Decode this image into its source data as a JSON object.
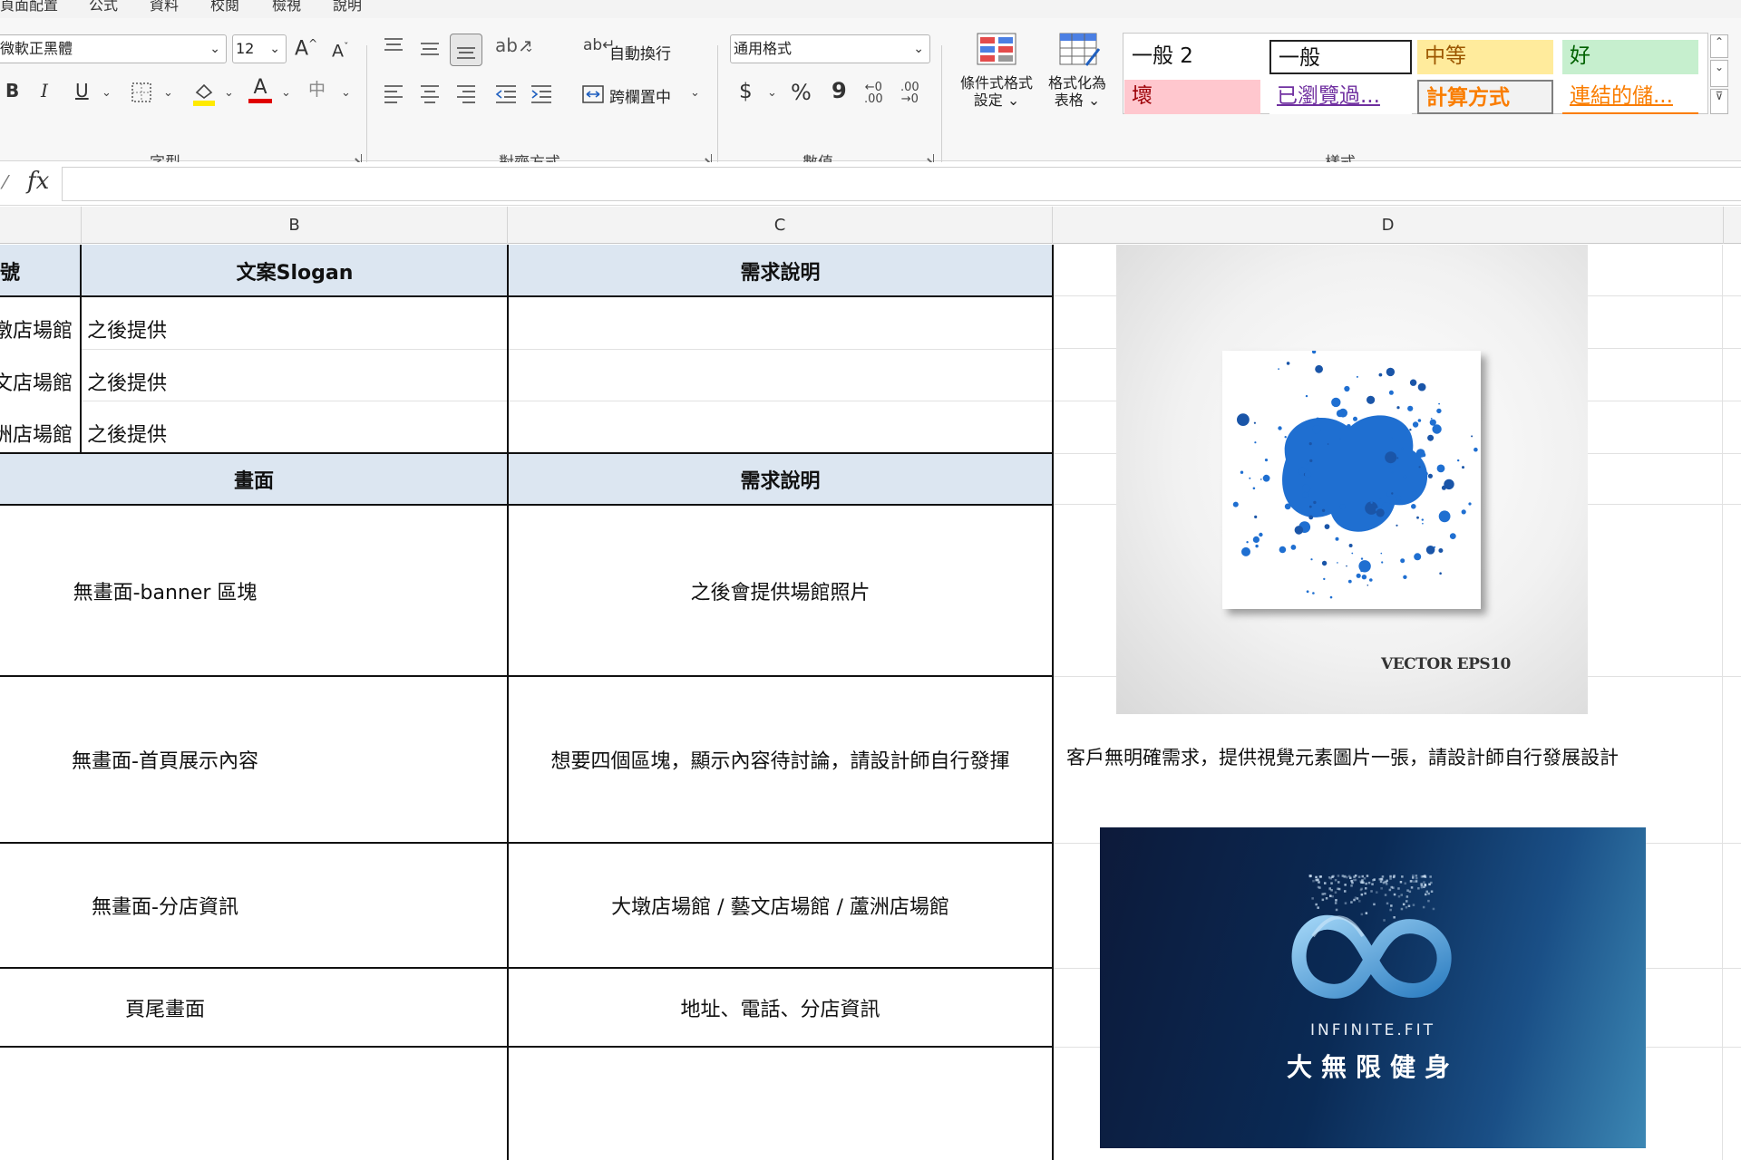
{
  "ribbon_tabs": [
    "頁面配置",
    "公式",
    "資料",
    "校閱",
    "檢視",
    "說明"
  ],
  "font_group": {
    "label": "字型",
    "font_name": "微軟正黑體",
    "font_size": "12",
    "bold": "B",
    "italic": "I",
    "underline": "U",
    "grow_font": "A",
    "shrink_font": "A",
    "font_color_glyph": "A",
    "phonetic": "中"
  },
  "alignment_group": {
    "label": "對齊方式",
    "wrap_text": "自動換行",
    "merge_center": "跨欄置中"
  },
  "number_group": {
    "label": "數值",
    "format": "通用格式",
    "currency": "$",
    "percent": "%",
    "comma": "9"
  },
  "styles_group": {
    "label": "樣式",
    "conditional_formatting": [
      "條件式格式",
      "設定"
    ],
    "format_as_table": [
      "格式化為",
      "表格"
    ],
    "cells": [
      {
        "text": "一般 2",
        "bg": "#ffffff",
        "color": "#111111"
      },
      {
        "text": "一般",
        "bg": "#ffffff",
        "color": "#111111"
      },
      {
        "text": "中等",
        "bg": "#ffeb9c",
        "color": "#9c5700"
      },
      {
        "text": "好",
        "bg": "#c6efce",
        "color": "#006100"
      },
      {
        "text": "壞",
        "bg": "#ffc7ce",
        "color": "#9c0006"
      },
      {
        "text": "已瀏覽過...",
        "bg": "#ffffff",
        "color": "#7030a0"
      },
      {
        "text": "計算方式",
        "bg": "#f2f2f2",
        "color": "#fa7d00"
      },
      {
        "text": "連結的儲...",
        "bg": "#ffffff",
        "color": "#fa7d00"
      }
    ]
  },
  "formula_bar": {
    "fx": "fx",
    "value": ""
  },
  "columns": [
    "B",
    "C",
    "D"
  ],
  "table1": {
    "headers": [
      "號",
      "文案Slogan",
      "需求說明"
    ],
    "rows": [
      [
        "墩店場館",
        "之後提供",
        ""
      ],
      [
        "文店場館",
        "之後提供",
        ""
      ],
      [
        "洲店場館",
        "之後提供",
        ""
      ]
    ]
  },
  "table2": {
    "headers": [
      "畫面",
      "需求說明"
    ],
    "rows": [
      [
        "無畫面-banner 區塊",
        "之後會提供場館照片"
      ],
      [
        "無畫面-首頁展示內容",
        "想要四個區塊，顯示內容待討論，請設計師自行發揮"
      ],
      [
        "無畫面-分店資訊",
        "大墩店場館 / 藝文店場館 / 蘆洲店場館"
      ],
      [
        "頁尾畫面",
        "地址、電話、分店資訊"
      ]
    ]
  },
  "column_d": {
    "picture_caption": "VECTOR EPS10",
    "note": "客戶無明確需求，提供視覺元素圖片一張，請設計師自行發展設計",
    "logo_en": "INFINITE.FIT",
    "logo_zh": "大無限健身"
  },
  "colors": {
    "header_fill": "#dce6f1",
    "splash_blue": "#1f6fd1",
    "logo_blue": "#4aa3e0"
  }
}
